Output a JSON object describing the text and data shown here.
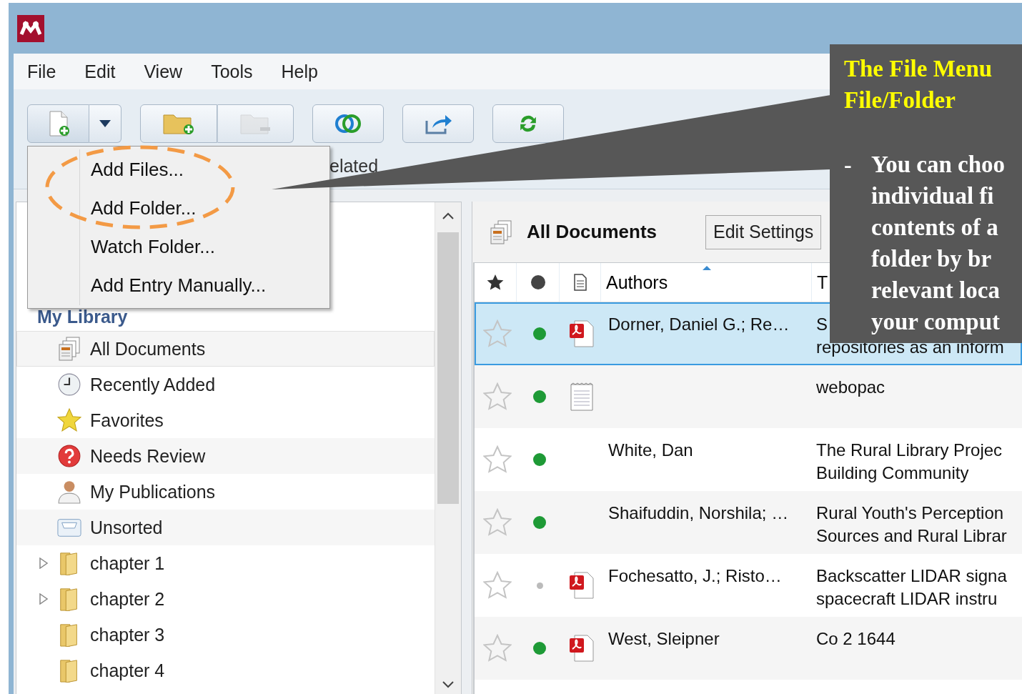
{
  "menu_bar": [
    "File",
    "Edit",
    "View",
    "Tools",
    "Help"
  ],
  "toolbar": {
    "buttons": [
      {
        "kind": "add_file",
        "disabled": false,
        "pressed": true
      },
      {
        "kind": "dropdown",
        "disabled": false,
        "pressed": false
      },
      {
        "kind": "add_folder",
        "disabled": false,
        "pressed": false
      },
      {
        "kind": "remove_folder",
        "disabled": true,
        "pressed": false
      },
      {
        "kind": "related",
        "disabled": false,
        "pressed": false,
        "label": "elated"
      },
      {
        "kind": "share",
        "disabled": false,
        "pressed": false
      },
      {
        "kind": "sync",
        "disabled": false,
        "pressed": false
      }
    ]
  },
  "add_menu": {
    "items": [
      "Add Files...",
      "Add Folder...",
      "Watch Folder...",
      "Add Entry Manually..."
    ]
  },
  "sidebar": {
    "heading": "My Library",
    "items": [
      {
        "kind": "all_documents",
        "label": "All Documents",
        "selected": true
      },
      {
        "kind": "recent",
        "label": "Recently Added",
        "selected": false
      },
      {
        "kind": "favorites",
        "label": "Favorites",
        "selected": false
      },
      {
        "kind": "review",
        "label": "Needs Review",
        "selected": false
      },
      {
        "kind": "publications",
        "label": "My Publications",
        "selected": false
      },
      {
        "kind": "unsorted",
        "label": "Unsorted",
        "selected": false
      },
      {
        "kind": "folder",
        "label": "chapter 1",
        "selected": false,
        "expanded": false
      },
      {
        "kind": "folder",
        "label": "chapter 2",
        "selected": false,
        "expanded": false
      },
      {
        "kind": "folder",
        "label": "chapter 3",
        "selected": false
      },
      {
        "kind": "folder",
        "label": "chapter 4",
        "selected": false
      }
    ]
  },
  "documents": {
    "title": "All Documents",
    "edit_button": "Edit Settings",
    "columns": [
      {
        "kind": "star"
      },
      {
        "kind": "read"
      },
      {
        "kind": "file"
      },
      {
        "kind": "text",
        "label": "Authors",
        "sorted": true
      },
      {
        "kind": "text",
        "label": "T",
        "sorted": false
      }
    ],
    "rows": [
      {
        "selected": true,
        "starred": false,
        "unread": true,
        "kind": "pdf",
        "authors": "Dorner, Daniel G.; Re…",
        "title_lines": [
          "S",
          "repositories as an inform"
        ]
      },
      {
        "selected": false,
        "starred": false,
        "unread": true,
        "kind": "note",
        "title_lines": [
          "webopac"
        ]
      },
      {
        "selected": false,
        "starred": false,
        "unread": true,
        "kind": "plain",
        "authors": "White, Dan",
        "title_lines": [
          "The Rural Library Projec",
          "Building Community"
        ]
      },
      {
        "selected": false,
        "starred": false,
        "unread": true,
        "kind": "plain",
        "authors": "Shaifuddin, Norshila; …",
        "title_lines": [
          "Rural Youth's Perception",
          "Sources and Rural Librar"
        ]
      },
      {
        "selected": false,
        "starred": false,
        "unread": false,
        "kind": "pdf",
        "authors": "Fochesatto, J.; Risto…",
        "title_lines": [
          "Backscatter LIDAR signa",
          "spacecraft LIDAR instru"
        ]
      },
      {
        "selected": false,
        "starred": false,
        "unread": true,
        "kind": "pdf",
        "authors": "West, Sleipner",
        "title_lines": [
          "Co 2 1644"
        ]
      }
    ]
  },
  "callout": {
    "title_lines": [
      "The File Menu",
      "File/Folder"
    ],
    "bullet": "-",
    "body_lines": [
      "You can choo",
      "individual fi",
      "contents of a",
      "folder by br",
      "relevant loca",
      "your comput"
    ]
  }
}
